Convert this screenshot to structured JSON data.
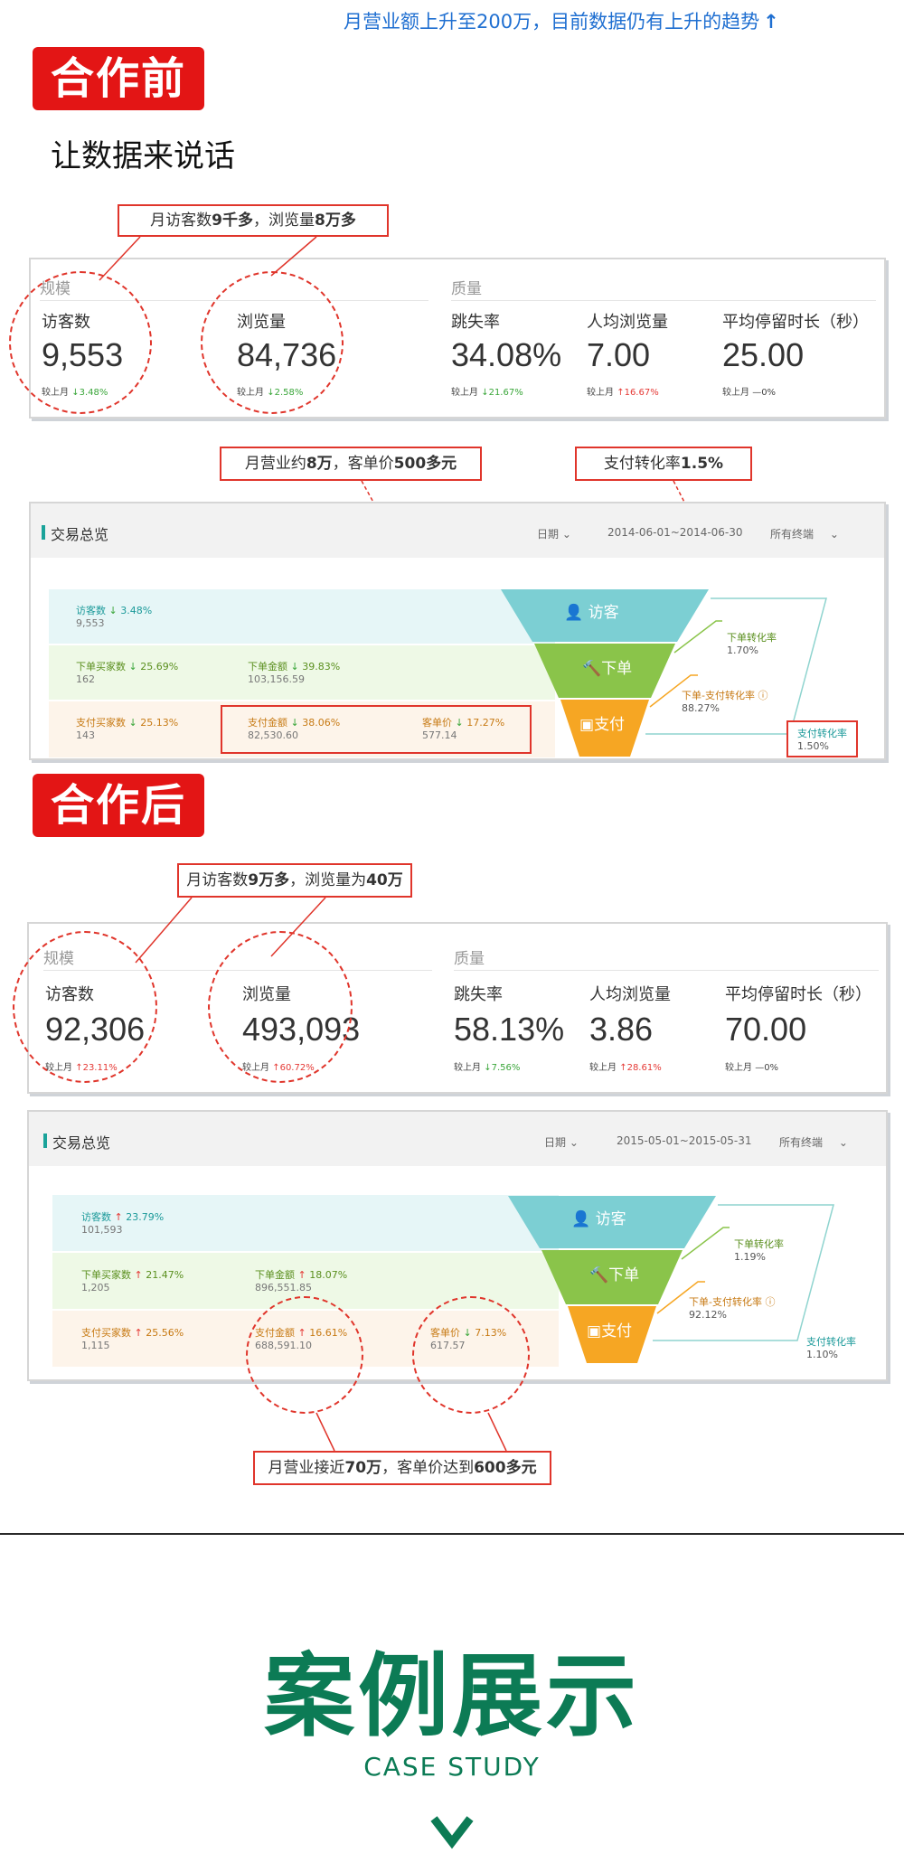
{
  "top_note": "月营业额上升至200万，目前数据仍有上升的趋势",
  "before": {
    "badge": "合作前",
    "subtitle": "让数据来说话",
    "callout_traffic": {
      "pre": "月访客数",
      "b1": "9千多",
      "mid": "，浏览量",
      "b2": "8万多"
    },
    "scale_label": "规模",
    "quality_label": "质量",
    "compare_label": "较上月",
    "metrics": [
      {
        "label": "访客数",
        "value": "9,553",
        "pct": "3.48%",
        "dir": "down"
      },
      {
        "label": "浏览量",
        "value": "84,736",
        "pct": "2.58%",
        "dir": "down"
      },
      {
        "label": "跳失率",
        "value": "34.08%",
        "pct": "21.67%",
        "dir": "down"
      },
      {
        "label": "人均浏览量",
        "value": "7.00",
        "pct": "16.67%",
        "dir": "up"
      },
      {
        "label": "平均停留时长（秒）",
        "value": "25.00",
        "pct": "0%",
        "dir": "flat"
      }
    ],
    "callout_revenue": {
      "pre": "月营业约",
      "b1": "8万",
      "mid": "，客单价",
      "b2": "500多元"
    },
    "callout_rate": {
      "pre": "支付转化率",
      "b1": "1.5%"
    },
    "trade": {
      "title": "交易总览",
      "date_label": "日期",
      "date_range": "2014-06-01~2014-06-30",
      "terminal": "所有终端",
      "rows": [
        {
          "label": "访客数",
          "pct": "3.48%",
          "dir": "down",
          "value": "9,553"
        },
        {
          "label": "下单买家数",
          "pct": "25.69%",
          "dir": "down",
          "value": "162"
        },
        {
          "label": "下单金额",
          "pct": "39.83%",
          "dir": "down",
          "value": "103,156.59"
        },
        {
          "label": "支付买家数",
          "pct": "25.13%",
          "dir": "down",
          "value": "143"
        },
        {
          "label": "支付金额",
          "pct": "38.06%",
          "dir": "down",
          "value": "82,530.60"
        },
        {
          "label": "客单价",
          "pct": "17.27%",
          "dir": "down",
          "value": "577.14"
        }
      ],
      "funnel": [
        "访客",
        "下单",
        "支付"
      ],
      "order_rate": {
        "label": "下单转化率",
        "value": "1.70%"
      },
      "order_pay_rate": {
        "label": "下单-支付转化率",
        "value": "88.27%"
      },
      "pay_rate": {
        "label": "支付转化率",
        "value": "1.50%"
      }
    }
  },
  "after": {
    "badge": "合作后",
    "callout_traffic": {
      "pre": "月访客数",
      "b1": "9万多",
      "mid": "，浏览量为",
      "b2": "40万"
    },
    "scale_label": "规模",
    "quality_label": "质量",
    "compare_label": "较上月",
    "metrics": [
      {
        "label": "访客数",
        "value": "92,306",
        "pct": "23.11%",
        "dir": "up"
      },
      {
        "label": "浏览量",
        "value": "493,093",
        "pct": "60.72%",
        "dir": "up"
      },
      {
        "label": "跳失率",
        "value": "58.13%",
        "pct": "7.56%",
        "dir": "down"
      },
      {
        "label": "人均浏览量",
        "value": "3.86",
        "pct": "28.61%",
        "dir": "up"
      },
      {
        "label": "平均停留时长（秒）",
        "value": "70.00",
        "pct": "0%",
        "dir": "flat"
      }
    ],
    "trade": {
      "title": "交易总览",
      "date_label": "日期",
      "date_range": "2015-05-01~2015-05-31",
      "terminal": "所有终端",
      "rows": [
        {
          "label": "访客数",
          "pct": "23.79%",
          "dir": "up",
          "value": "101,593"
        },
        {
          "label": "下单买家数",
          "pct": "21.47%",
          "dir": "up",
          "value": "1,205"
        },
        {
          "label": "下单金额",
          "pct": "18.07%",
          "dir": "up",
          "value": "896,551.85"
        },
        {
          "label": "支付买家数",
          "pct": "25.56%",
          "dir": "up",
          "value": "1,115"
        },
        {
          "label": "支付金额",
          "pct": "16.61%",
          "dir": "up",
          "value": "688,591.10"
        },
        {
          "label": "客单价",
          "pct": "7.13%",
          "dir": "down",
          "value": "617.57"
        }
      ],
      "funnel": [
        "访客",
        "下单",
        "支付"
      ],
      "order_rate": {
        "label": "下单转化率",
        "value": "1.19%"
      },
      "order_pay_rate": {
        "label": "下单-支付转化率",
        "value": "92.12%"
      },
      "pay_rate": {
        "label": "支付转化率",
        "value": "1.10%"
      }
    },
    "callout_revenue": {
      "pre": "月营业接近",
      "b1": "70万",
      "mid": "，客单价达到",
      "b2": "600多元"
    }
  },
  "case": {
    "title": "案例展示",
    "subtitle": "CASE STUDY"
  },
  "colors": {
    "accent_red": "#e31515",
    "brand_green": "#0c7b55",
    "funnel_teal": "#7ccfd3",
    "funnel_green": "#8ac44a",
    "funnel_orange": "#f6a623",
    "link_blue": "#1f6fd1"
  }
}
